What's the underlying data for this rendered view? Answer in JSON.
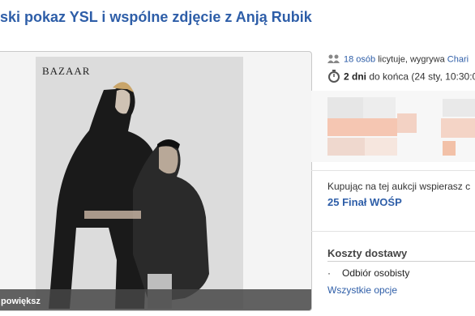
{
  "auction": {
    "title": "ski pokaz YSL i wspólne zdjęcie z Anją Rubik"
  },
  "gallery": {
    "magazine_logo": "BAZAAR",
    "enlarge_label": "powiększ"
  },
  "bidding": {
    "bidders_link": "18 osób",
    "bidders_text": " licytuje, wygrywa ",
    "winner_link": "Chari",
    "time_bold": "2 dni",
    "time_text": " do końca (24 sty, 10:30:00"
  },
  "charity": {
    "text": "Kupując na tej aukcji wspierasz c",
    "link": "25 Finał WOŚP"
  },
  "shipping": {
    "heading": "Koszty dostawy",
    "options": [
      "Odbiór osobisty"
    ],
    "all_options_link": "Wszystkie opcje"
  },
  "colors": {
    "link": "#2e5ea8",
    "blur_orange": "#f6c9b4"
  }
}
